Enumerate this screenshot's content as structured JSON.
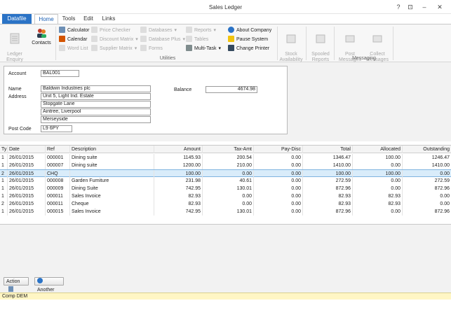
{
  "window": {
    "title": "Sales Ledger",
    "controls": [
      "?",
      "⊡",
      "–",
      "✕"
    ]
  },
  "tabs": [
    {
      "label": "Datafile"
    },
    {
      "label": "Home"
    },
    {
      "label": "Tools"
    },
    {
      "label": "Edit"
    },
    {
      "label": "Links"
    }
  ],
  "ribbon": {
    "ledger_enquiry": "Ledger\nEnquiry",
    "contacts": "Contacts",
    "calculator": "Calculator",
    "calendar": "Calendar",
    "word_list": "Word List",
    "price_checker": "Price Checker",
    "discount_matrix": "Discount Matrix",
    "supplier_matrix": "Supplier Matrix",
    "databases": "Databases",
    "database_plus": "Database Plus",
    "forms": "Forms",
    "reports": "Reports",
    "tables": "Tables",
    "multi_task": "Multi-Task",
    "about_company": "About Company",
    "pause_system": "Pause System",
    "change_printer": "Change Printer",
    "utilities_group": "Utilities",
    "stock_availability": "Stock\nAvailability",
    "spooled_reports": "Spooled\nReports",
    "post_messages": "Post\nMessages",
    "collect_messages": "Collect\nMessages",
    "messaging_group": "Messaging"
  },
  "account": {
    "account_label": "Account",
    "account_value": "BAL001",
    "name_label": "Name",
    "name_value": "Baldwin Industries plc",
    "address_label": "Address",
    "address_lines": [
      "Unit 5, Light Ind. Estate",
      "Stopgate Lane",
      "Aintree, Liverpool",
      "Merseyside"
    ],
    "postcode_label": "Post Code",
    "postcode_value": "L9 6PY",
    "balance_label": "Balance",
    "balance_value": "4674.98"
  },
  "grid": {
    "columns": [
      "Ty",
      "Date",
      "Ref",
      "Description",
      "Amount",
      "Tax-Amt",
      "Pay-Disc",
      "Total",
      "Allocated",
      "Outstanding"
    ],
    "rows": [
      [
        "1",
        "26/01/2015",
        "000001",
        "Dining suite",
        "1145.93",
        "200.54",
        "0.00",
        "1346.47",
        "100.00",
        "1246.47"
      ],
      [
        "1",
        "26/01/2015",
        "000007",
        "Dining suite",
        "1200.00",
        "210.00",
        "0.00",
        "1410.00",
        "0.00",
        "1410.00"
      ],
      [
        "2",
        "26/01/2015",
        "CHQ",
        "",
        "100.00",
        "0.00",
        "0.00",
        "100.00",
        "100.00",
        "0.00"
      ],
      [
        "1",
        "26/01/2015",
        "000008",
        "Garden Furniture",
        "231.98",
        "40.61",
        "0.00",
        "272.59",
        "0.00",
        "272.59"
      ],
      [
        "1",
        "26/01/2015",
        "000009",
        "Dining Suite",
        "742.95",
        "130.01",
        "0.00",
        "872.96",
        "0.00",
        "872.96"
      ],
      [
        "1",
        "26/01/2015",
        "000011",
        "Sales Invoice",
        "82.93",
        "0.00",
        "0.00",
        "82.93",
        "82.93",
        "0.00"
      ],
      [
        "2",
        "26/01/2015",
        "000011",
        "Cheque",
        "82.93",
        "0.00",
        "0.00",
        "82.93",
        "82.93",
        "0.00"
      ],
      [
        "1",
        "26/01/2015",
        "000015",
        "Sales Invoice",
        "742.95",
        "130.01",
        "0.00",
        "872.96",
        "0.00",
        "872.96"
      ]
    ],
    "selected_index": 2
  },
  "actions": {
    "action_label": "Action",
    "another_label": "Another"
  },
  "status": {
    "company": "Comp DEM"
  },
  "colors": {
    "accent": "#2b73c6",
    "selection": "#d9ecfa",
    "status": "#fff6c4"
  }
}
